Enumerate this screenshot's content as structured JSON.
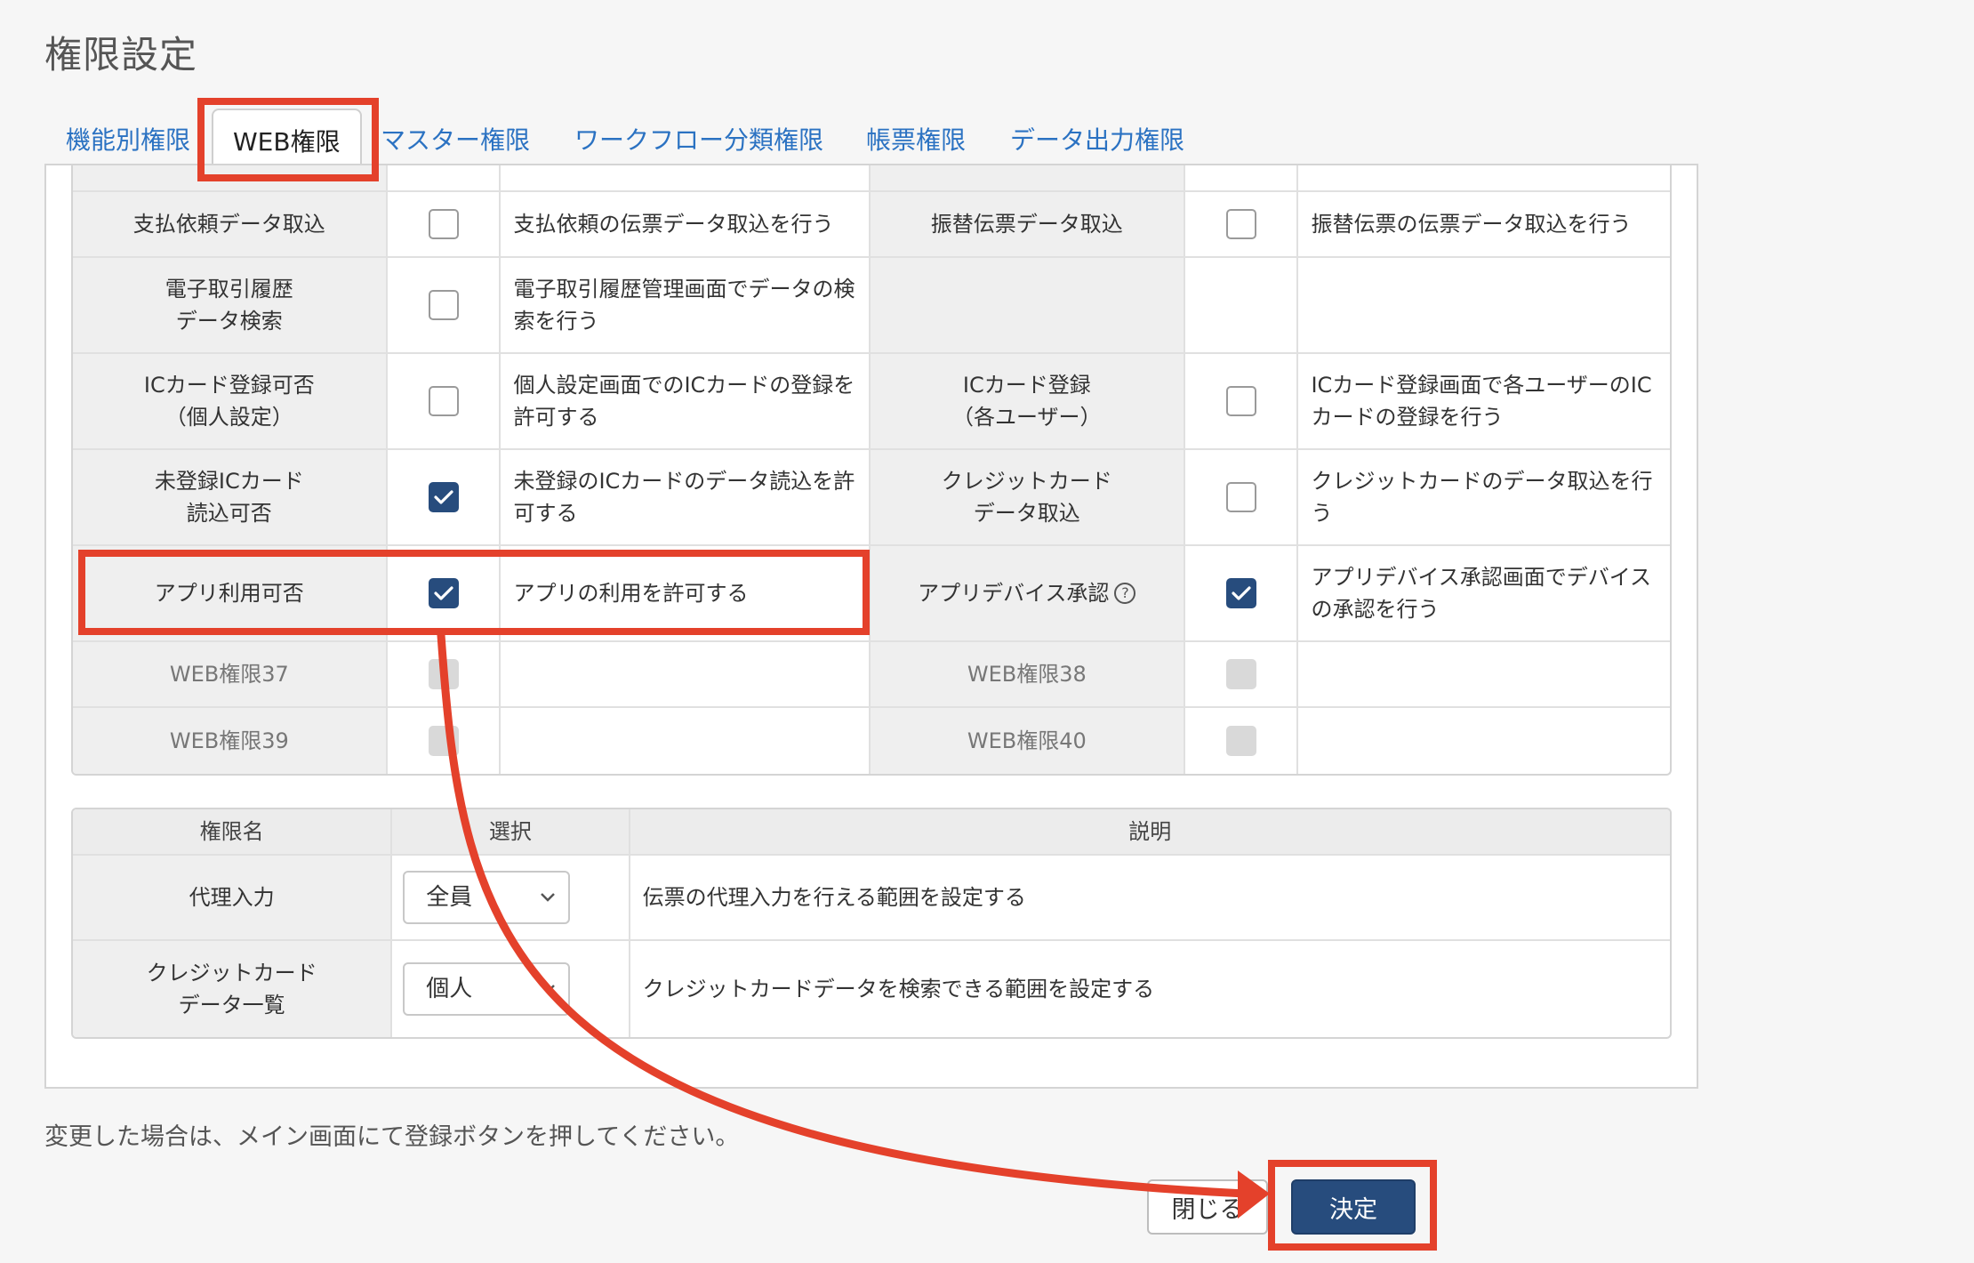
{
  "title": "権限設定",
  "tabs": [
    {
      "label": "機能別権限"
    },
    {
      "label": "WEB権限"
    },
    {
      "label": "マスター権限"
    },
    {
      "label": "ワークフロー分類権限"
    },
    {
      "label": "帳票権限"
    },
    {
      "label": "データ出力権限"
    }
  ],
  "active_tab": "WEB権限",
  "web_rows": [
    {
      "name1": "支払依頼データ取込",
      "chk1": "off",
      "desc1": "支払依頼の伝票データ取込を行う",
      "name2": "振替伝票データ取込",
      "chk2": "off",
      "desc2": "振替伝票の伝票データ取込を行う"
    },
    {
      "name1": "電子取引履歴\nデータ検索",
      "chk1": "off",
      "desc1": "電子取引履歴管理画面でデータの検索を行う",
      "name2": "",
      "chk2": "none",
      "desc2": ""
    },
    {
      "name1": "ICカード登録可否\n（個人設定）",
      "chk1": "off",
      "desc1": "個人設定画面でのICカードの登録を許可する",
      "name2": "ICカード登録\n（各ユーザー）",
      "chk2": "off",
      "desc2": "ICカード登録画面で各ユーザーのICカードの登録を行う"
    },
    {
      "name1": "未登録ICカード\n読込可否",
      "chk1": "on",
      "desc1": "未登録のICカードのデータ読込を許可する",
      "name2": "クレジットカード\nデータ取込",
      "chk2": "off",
      "desc2": "クレジットカードのデータ取込を行う"
    },
    {
      "name1": "アプリ利用可否",
      "chk1": "on",
      "desc1": "アプリの利用を許可する",
      "name2": "アプリデバイス承認",
      "chk2": "on",
      "desc2": "アプリデバイス承認画面でデバイスの承認を行う"
    },
    {
      "name1": "WEB権限37",
      "chk1": "disabled",
      "desc1": "",
      "name2": "WEB権限38",
      "chk2": "disabled",
      "desc2": ""
    },
    {
      "name1": "WEB権限39",
      "chk1": "disabled",
      "desc1": "",
      "name2": "WEB権限40",
      "chk2": "disabled",
      "desc2": ""
    }
  ],
  "scope_table": {
    "headers": [
      "権限名",
      "選択",
      "説明"
    ],
    "rows": [
      {
        "name": "代理入力",
        "selected": "全員",
        "desc": "伝票の代理入力を行える範囲を設定する"
      },
      {
        "name": "クレジットカード\nデータ一覧",
        "selected": "個人",
        "desc": "クレジットカードデータを検索できる範囲を設定する"
      }
    ]
  },
  "note": "変更した場合は、メイン画面にて登録ボタンを押してください。",
  "buttons": {
    "close": "閉じる",
    "decide": "決定"
  },
  "colors": {
    "accent": "#274c7d",
    "link": "#2b72c2",
    "highlight": "#e4412b"
  },
  "icons": {
    "help": "question-circle-icon",
    "check": "check-icon",
    "dropdown": "chevron-down-icon"
  }
}
